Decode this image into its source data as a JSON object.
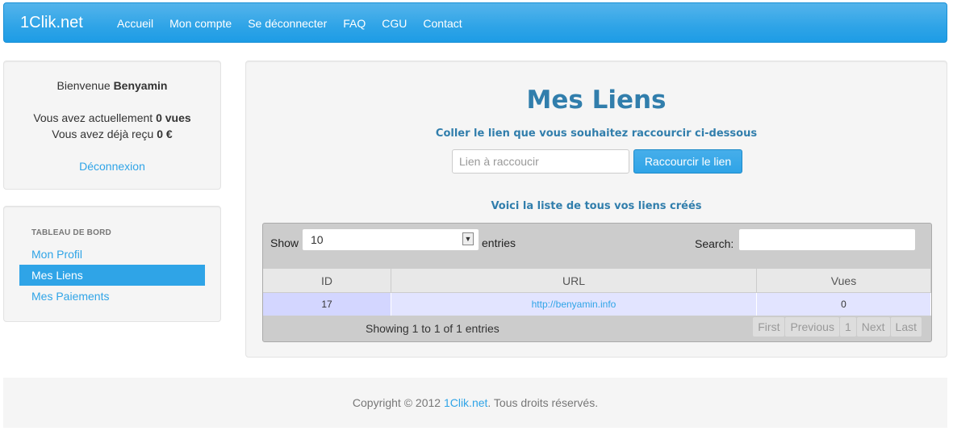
{
  "navbar": {
    "brand": "1Clik.net",
    "links": [
      "Accueil",
      "Mon compte",
      "Se déconnecter",
      "FAQ",
      "CGU",
      "Contact"
    ]
  },
  "welcome": {
    "greeting": "Bienvenue",
    "username": "Benyamin",
    "views_prefix": "Vous avez actuellement",
    "views_value": "0 vues",
    "earned_prefix": "Vous avez déjà reçu",
    "earned_value": "0 €",
    "logout": "Déconnexion"
  },
  "dashboard": {
    "header": "TABLEAU DE BORD",
    "items": [
      {
        "label": "Mon Profil",
        "active": false
      },
      {
        "label": "Mes Liens",
        "active": true
      },
      {
        "label": "Mes Paiements",
        "active": false
      }
    ]
  },
  "main": {
    "title": "Mes Liens",
    "instruction": "Coller le lien que vous souhaitez raccourcir ci-dessous",
    "input_placeholder": "Lien à raccoucir",
    "button": "Raccourcir le lien",
    "list_title": "Voici la liste de tous vos liens créés"
  },
  "table": {
    "show_label": "Show",
    "page_size": "10",
    "entries_label": "entries",
    "search_label": "Search:",
    "columns": [
      "ID",
      "URL",
      "Vues"
    ],
    "rows": [
      {
        "id": "17",
        "url": "http://benyamin.info",
        "views": "0"
      }
    ],
    "info": "Showing 1 to 1 of 1 entries",
    "pager": {
      "first": "First",
      "previous": "Previous",
      "page": "1",
      "next": "Next",
      "last": "Last"
    }
  },
  "footer": {
    "copyright": "Copyright © 2012",
    "site": "1Clik.net",
    "rights": ". Tous droits réservés."
  },
  "colors": {
    "accent": "#2fa4e7",
    "heading": "#317eac"
  }
}
